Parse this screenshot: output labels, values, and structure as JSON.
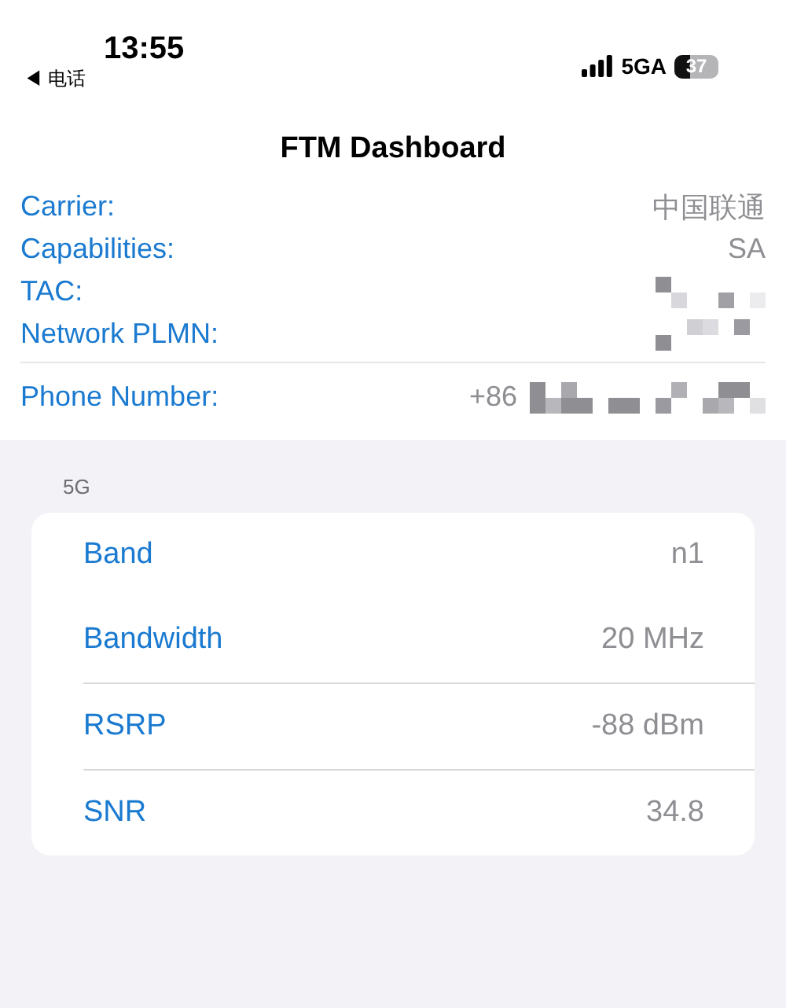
{
  "status_bar": {
    "time": "13:55",
    "back_label": "◀ 电话",
    "network": "5GA",
    "battery": "37"
  },
  "title": "FTM Dashboard",
  "info_rows": [
    {
      "label": "Carrier:",
      "value": "中国联通",
      "redacted": false,
      "divider_after": false
    },
    {
      "label": "Capabilities:",
      "value": "SA",
      "redacted": false,
      "divider_after": false
    },
    {
      "label": "TAC:",
      "redacted": true,
      "divider_after": false
    },
    {
      "label": "Network PLMN:",
      "redacted": true,
      "divider_after": true
    },
    {
      "label": "Phone Number:",
      "value": "+86",
      "redacted": true,
      "divider_after": false
    }
  ],
  "section": {
    "header": "5G",
    "rows": [
      {
        "label": "Band",
        "value": "n1",
        "divider_after": false
      },
      {
        "label": "Bandwidth",
        "value": "20 MHz",
        "divider_after": true
      },
      {
        "label": "RSRP",
        "value": "-88 dBm",
        "divider_after": true
      },
      {
        "label": "SNR",
        "value": "34.8",
        "divider_after": false
      }
    ]
  }
}
